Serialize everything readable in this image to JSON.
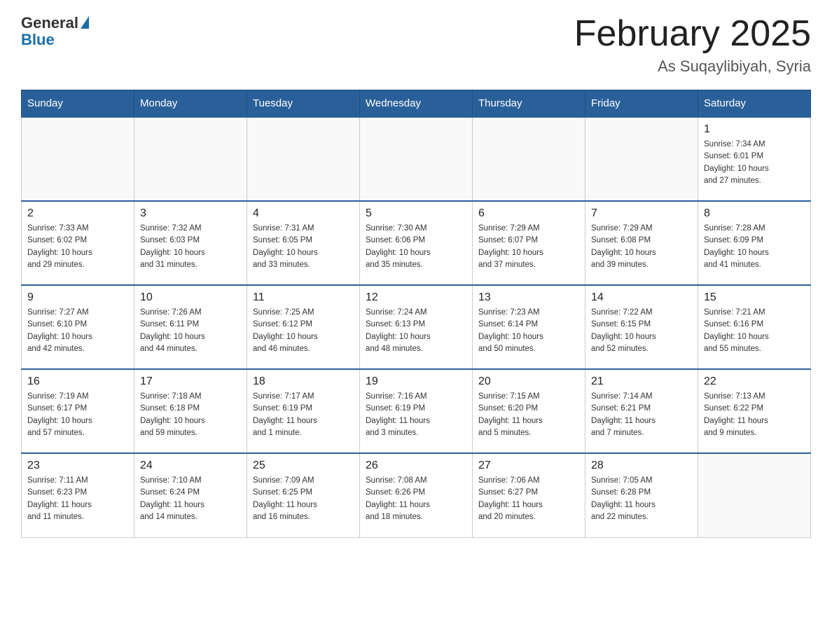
{
  "header": {
    "logo_general": "General",
    "logo_blue": "Blue",
    "month_title": "February 2025",
    "location": "As Suqaylibiyah, Syria"
  },
  "weekdays": [
    "Sunday",
    "Monday",
    "Tuesday",
    "Wednesday",
    "Thursday",
    "Friday",
    "Saturday"
  ],
  "weeks": [
    [
      {
        "day": "",
        "info": ""
      },
      {
        "day": "",
        "info": ""
      },
      {
        "day": "",
        "info": ""
      },
      {
        "day": "",
        "info": ""
      },
      {
        "day": "",
        "info": ""
      },
      {
        "day": "",
        "info": ""
      },
      {
        "day": "1",
        "info": "Sunrise: 7:34 AM\nSunset: 6:01 PM\nDaylight: 10 hours\nand 27 minutes."
      }
    ],
    [
      {
        "day": "2",
        "info": "Sunrise: 7:33 AM\nSunset: 6:02 PM\nDaylight: 10 hours\nand 29 minutes."
      },
      {
        "day": "3",
        "info": "Sunrise: 7:32 AM\nSunset: 6:03 PM\nDaylight: 10 hours\nand 31 minutes."
      },
      {
        "day": "4",
        "info": "Sunrise: 7:31 AM\nSunset: 6:05 PM\nDaylight: 10 hours\nand 33 minutes."
      },
      {
        "day": "5",
        "info": "Sunrise: 7:30 AM\nSunset: 6:06 PM\nDaylight: 10 hours\nand 35 minutes."
      },
      {
        "day": "6",
        "info": "Sunrise: 7:29 AM\nSunset: 6:07 PM\nDaylight: 10 hours\nand 37 minutes."
      },
      {
        "day": "7",
        "info": "Sunrise: 7:29 AM\nSunset: 6:08 PM\nDaylight: 10 hours\nand 39 minutes."
      },
      {
        "day": "8",
        "info": "Sunrise: 7:28 AM\nSunset: 6:09 PM\nDaylight: 10 hours\nand 41 minutes."
      }
    ],
    [
      {
        "day": "9",
        "info": "Sunrise: 7:27 AM\nSunset: 6:10 PM\nDaylight: 10 hours\nand 42 minutes."
      },
      {
        "day": "10",
        "info": "Sunrise: 7:26 AM\nSunset: 6:11 PM\nDaylight: 10 hours\nand 44 minutes."
      },
      {
        "day": "11",
        "info": "Sunrise: 7:25 AM\nSunset: 6:12 PM\nDaylight: 10 hours\nand 46 minutes."
      },
      {
        "day": "12",
        "info": "Sunrise: 7:24 AM\nSunset: 6:13 PM\nDaylight: 10 hours\nand 48 minutes."
      },
      {
        "day": "13",
        "info": "Sunrise: 7:23 AM\nSunset: 6:14 PM\nDaylight: 10 hours\nand 50 minutes."
      },
      {
        "day": "14",
        "info": "Sunrise: 7:22 AM\nSunset: 6:15 PM\nDaylight: 10 hours\nand 52 minutes."
      },
      {
        "day": "15",
        "info": "Sunrise: 7:21 AM\nSunset: 6:16 PM\nDaylight: 10 hours\nand 55 minutes."
      }
    ],
    [
      {
        "day": "16",
        "info": "Sunrise: 7:19 AM\nSunset: 6:17 PM\nDaylight: 10 hours\nand 57 minutes."
      },
      {
        "day": "17",
        "info": "Sunrise: 7:18 AM\nSunset: 6:18 PM\nDaylight: 10 hours\nand 59 minutes."
      },
      {
        "day": "18",
        "info": "Sunrise: 7:17 AM\nSunset: 6:19 PM\nDaylight: 11 hours\nand 1 minute."
      },
      {
        "day": "19",
        "info": "Sunrise: 7:16 AM\nSunset: 6:19 PM\nDaylight: 11 hours\nand 3 minutes."
      },
      {
        "day": "20",
        "info": "Sunrise: 7:15 AM\nSunset: 6:20 PM\nDaylight: 11 hours\nand 5 minutes."
      },
      {
        "day": "21",
        "info": "Sunrise: 7:14 AM\nSunset: 6:21 PM\nDaylight: 11 hours\nand 7 minutes."
      },
      {
        "day": "22",
        "info": "Sunrise: 7:13 AM\nSunset: 6:22 PM\nDaylight: 11 hours\nand 9 minutes."
      }
    ],
    [
      {
        "day": "23",
        "info": "Sunrise: 7:11 AM\nSunset: 6:23 PM\nDaylight: 11 hours\nand 11 minutes."
      },
      {
        "day": "24",
        "info": "Sunrise: 7:10 AM\nSunset: 6:24 PM\nDaylight: 11 hours\nand 14 minutes."
      },
      {
        "day": "25",
        "info": "Sunrise: 7:09 AM\nSunset: 6:25 PM\nDaylight: 11 hours\nand 16 minutes."
      },
      {
        "day": "26",
        "info": "Sunrise: 7:08 AM\nSunset: 6:26 PM\nDaylight: 11 hours\nand 18 minutes."
      },
      {
        "day": "27",
        "info": "Sunrise: 7:06 AM\nSunset: 6:27 PM\nDaylight: 11 hours\nand 20 minutes."
      },
      {
        "day": "28",
        "info": "Sunrise: 7:05 AM\nSunset: 6:28 PM\nDaylight: 11 hours\nand 22 minutes."
      },
      {
        "day": "",
        "info": ""
      }
    ]
  ]
}
